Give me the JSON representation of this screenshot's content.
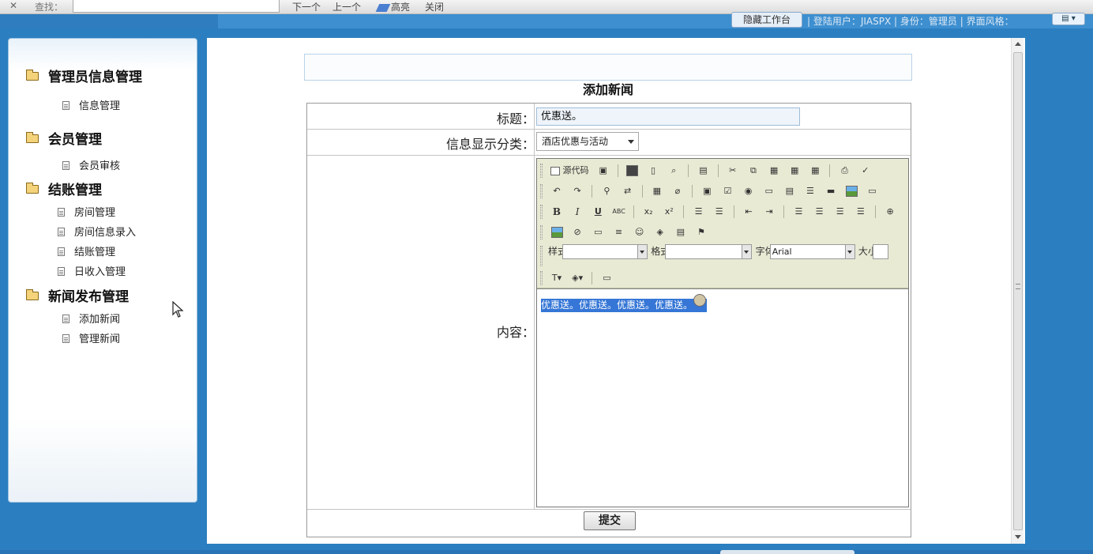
{
  "findbar": {
    "close_glyph": "✕",
    "label": "查找：",
    "value": "",
    "next": "下一个",
    "prev": "上一个",
    "highlight": "高亮",
    "close": "关闭"
  },
  "header": {
    "work_button": "隐藏工作台",
    "user_info": "| 登陆用户：JIASPX | 身份：管理员 | 界面风格：",
    "skin_button": "▤ ▾"
  },
  "sidebar": {
    "groups": [
      {
        "label": "管理员信息管理",
        "items": [
          "信息管理"
        ]
      },
      {
        "label": "会员管理",
        "items": [
          "会员审核"
        ]
      },
      {
        "label": "结账管理",
        "items": [
          "房间管理",
          "房间信息录入",
          "结账管理",
          "日收入管理"
        ]
      },
      {
        "label": "新闻发布管理",
        "items": [
          "添加新闻",
          "管理新闻"
        ]
      }
    ]
  },
  "form": {
    "title": "添加新闻",
    "title_label": "标题：",
    "title_value": "优惠送。",
    "category_label": "信息显示分类：",
    "category_value": "酒店优惠与活动",
    "content_label": "内容：",
    "content_value": "优惠送。优惠送。优惠送。优惠送。",
    "submit": "提交"
  },
  "editor": {
    "source_label": "源代码",
    "style_label": "样式",
    "format_label": "格式",
    "font_label": "字体",
    "font_value": "Arial",
    "size_label": "大小"
  }
}
